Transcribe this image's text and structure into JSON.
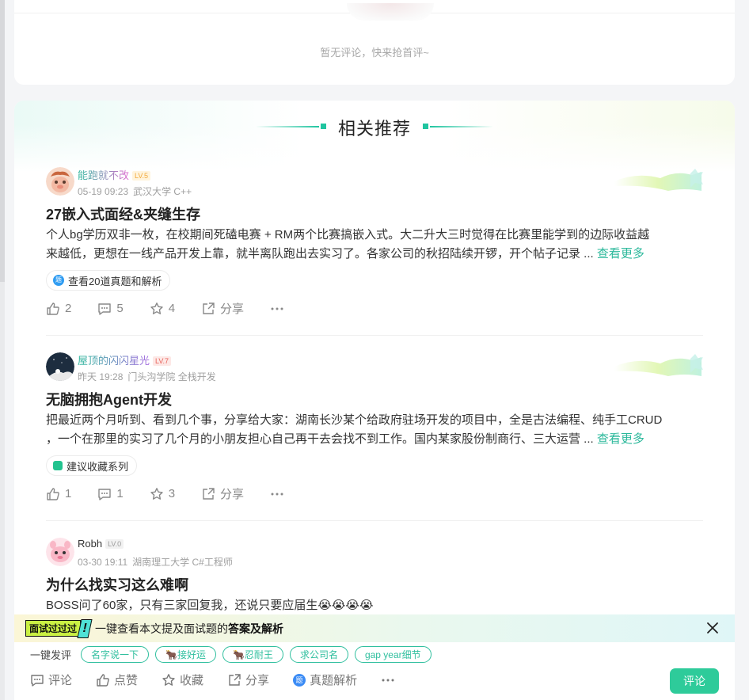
{
  "empty_comments": {
    "text": "暂无评论，快来抢首评~"
  },
  "recommend": {
    "title": "相关推荐",
    "posts": [
      {
        "username": "能跑就不改",
        "level": "LV.5",
        "date": "05-19 09:23",
        "school": "武汉大学 C++",
        "title": "27嵌入式面经&夹缝生存",
        "body_line1": "个人bg学历双非一枚，在校期间死磕电赛 + RM两个比赛搞嵌入式。大二升大三时觉得在比赛里能学到的边际收益越",
        "body_line2": "来越低，更想在一线产品开发上靠，就半离队跑出去实习了。各家公司的秋招陆续开锣，开个帖子记录 ...",
        "more": "查看更多",
        "tag": "查看20道真题和解析",
        "tag_icon": "题",
        "likes": "2",
        "comments": "5",
        "stars": "4",
        "share": "分享"
      },
      {
        "username": "屋顶的闪闪星光",
        "level": "LV.7",
        "date": "昨天 19:28",
        "school": "门头沟学院 全栈开发",
        "title": "无脑拥抱Agent开发",
        "body_line1": "把最近两个月听到、看到几个事，分享给大家：湖南长沙某个给政府驻场开发的项目中，全是古法编程、纯手工CRUD",
        "body_line2": "，一个在那里的实习了几个月的小朋友担心自己再干去会找不到工作。国内某家股份制商行、三大运营 ...",
        "more": "查看更多",
        "tag": "建议收藏系列",
        "likes": "1",
        "comments": "1",
        "stars": "3",
        "share": "分享"
      },
      {
        "username": "Robh",
        "level": "LV.0",
        "date": "03-30 19:11",
        "school": "湖南理工大学 C#工程师",
        "title": "为什么找实习这么难啊",
        "body_line1": "BOSS问了60家，只有三家回复我，还说只要应届生😭😭😭😭"
      }
    ]
  },
  "bottom": {
    "ad_badge": "面试过过过",
    "ad_excl": "!",
    "ad_text": "一键查看本文提及面试题的",
    "ad_highlight": "答案及解析",
    "quick_label": "一键发评",
    "chips": [
      "名字说一下",
      "🐂接好运",
      "🐂忍耐王",
      "求公司名",
      "gap year细节"
    ],
    "actions": {
      "comment": "评论",
      "like": "点赞",
      "collect": "收藏",
      "share": "分享",
      "analysis": "真题解析",
      "analysis_icon": "题"
    },
    "comment_button": "评论"
  },
  "colors": {
    "accent": "#2ecb9a",
    "link": "#2bb89b",
    "lv5": "#f2a93b",
    "lv7": "#e8625a",
    "lv0": "#9a9a9a"
  }
}
